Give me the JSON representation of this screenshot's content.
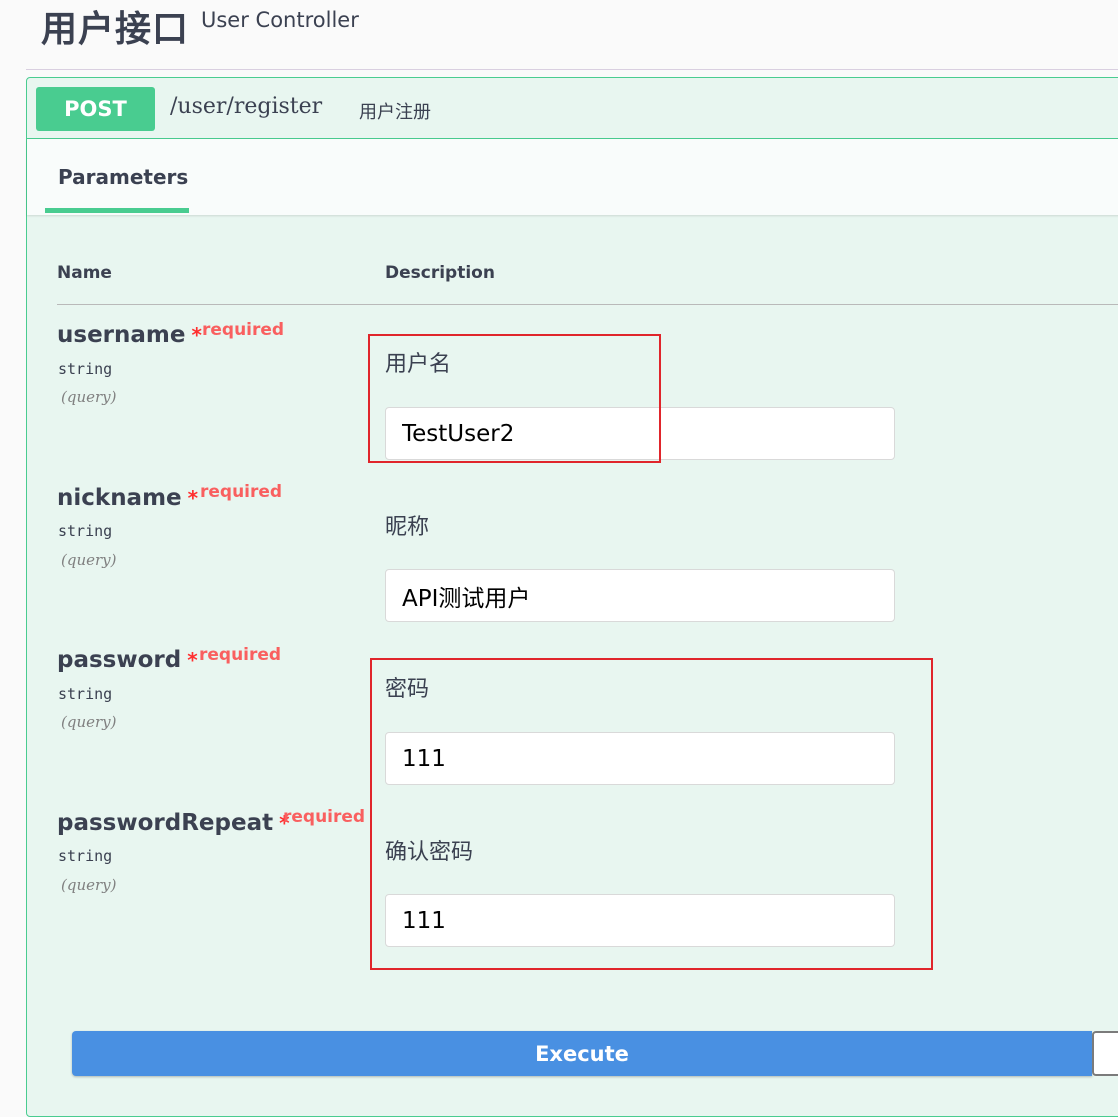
{
  "tag": {
    "title": "用户接口",
    "description": "User Controller"
  },
  "operation": {
    "method": "POST",
    "path": "/user/register",
    "summary": "用户注册",
    "accent_color": "#49cc90"
  },
  "tabs": {
    "parameters_label": "Parameters"
  },
  "table": {
    "name_header": "Name",
    "description_header": "Description"
  },
  "params": [
    {
      "name": "username",
      "star": "*",
      "required": "required",
      "type": "string",
      "in": "(query)",
      "description": "用户名",
      "value": "TestUser2"
    },
    {
      "name": "nickname",
      "star": "*",
      "required": "required",
      "type": "string",
      "in": "(query)",
      "description": "昵称",
      "value": "API测试用户"
    },
    {
      "name": "password",
      "star": "*",
      "required": "required",
      "type": "string",
      "in": "(query)",
      "description": "密码",
      "value": "111"
    },
    {
      "name": "passwordRepeat",
      "star": "*",
      "required": "required",
      "type": "string",
      "in": "(query)",
      "description": "确认密码",
      "value": "111"
    }
  ],
  "execute": {
    "label": "Execute",
    "color": "#4990e2"
  }
}
